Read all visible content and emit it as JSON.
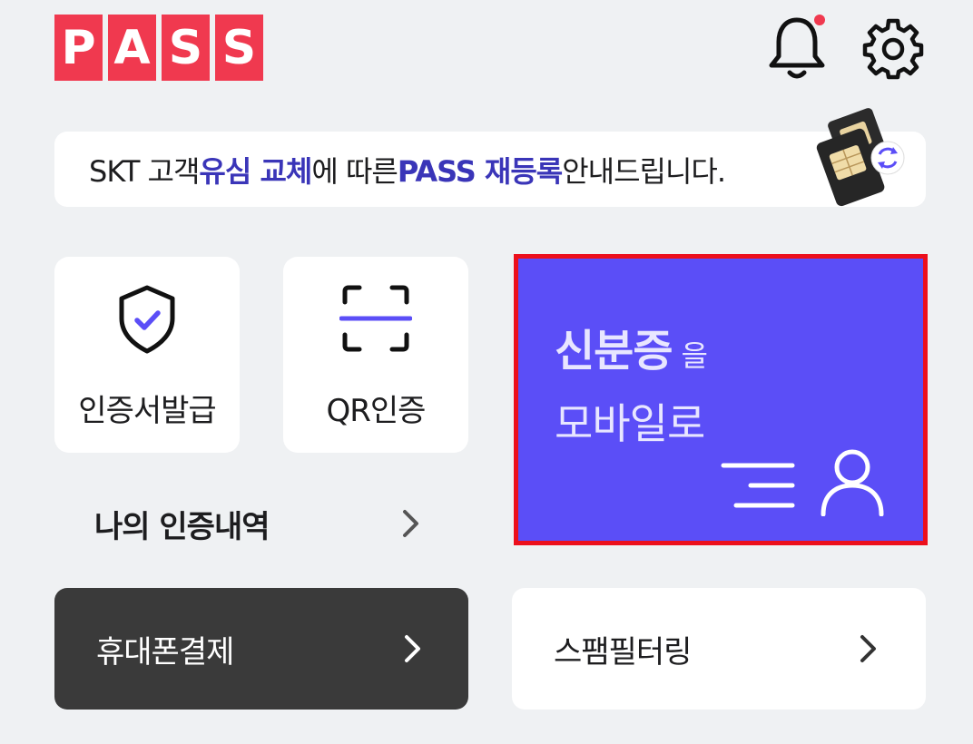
{
  "header": {
    "logo_letters": [
      "P",
      "A",
      "S",
      "S"
    ],
    "brand_color": "#f0394f",
    "notification_icon": "bell-icon",
    "settings_icon": "gear-icon"
  },
  "notice": {
    "part1": "SKT 고객 ",
    "part2": "유심 교체",
    "part3": "에 따른 ",
    "part4": "PASS 재등록",
    "part5": " 안내드립니다.",
    "highlight_color": "#3a35b8"
  },
  "tiles": {
    "cert": {
      "label": "인증서발급",
      "icon": "shield-check-icon"
    },
    "qr": {
      "label": "QR인증",
      "icon": "qr-scan-icon"
    }
  },
  "history": {
    "label": "나의 인증내역"
  },
  "idcard": {
    "title_bold": "신분증",
    "title_particle": "을",
    "subtitle": "모바일로",
    "bg_color": "#5b4ef7",
    "icon": "person-icon"
  },
  "buttons": {
    "payment": {
      "label": "휴대폰결제"
    },
    "spam": {
      "label": "스팸필터링"
    }
  }
}
